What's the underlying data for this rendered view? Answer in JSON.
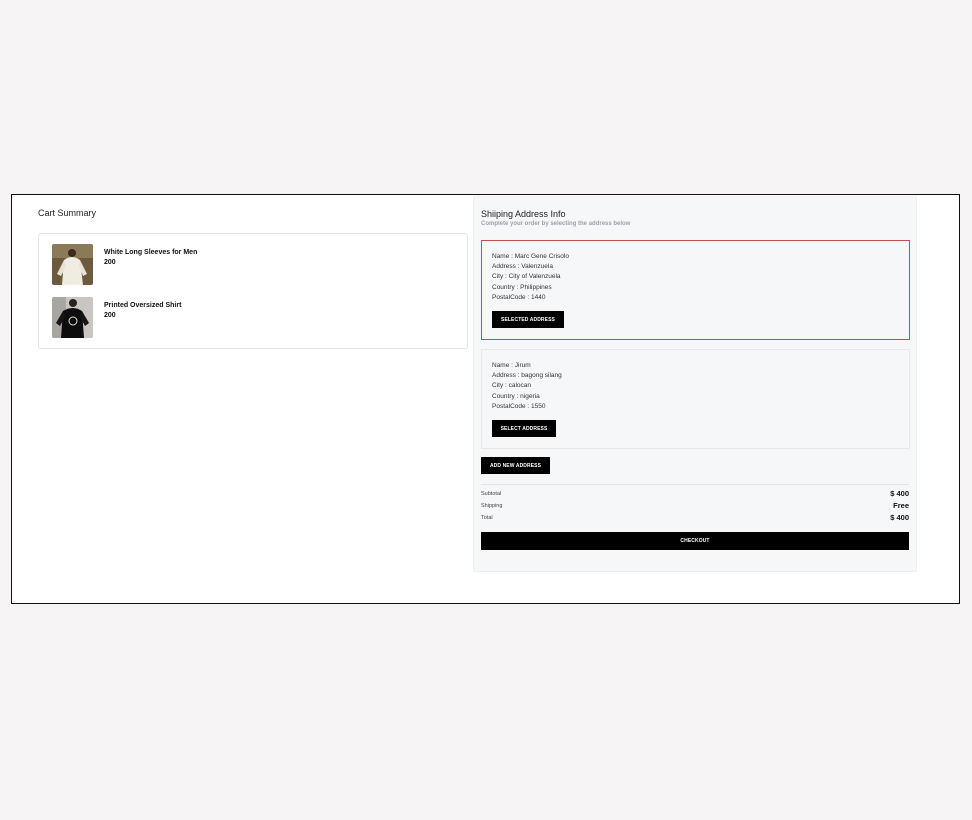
{
  "cart": {
    "title": "Cart Summary",
    "items": [
      {
        "name": "White Long Sleeves for Men",
        "price": "200"
      },
      {
        "name": "Printed Oversized Shirt",
        "price": "200"
      }
    ]
  },
  "shipping": {
    "title": "Shiiping Address Info",
    "subtitle": "Complete your order by selecting the address below",
    "addresses": [
      {
        "name": "Name : Marc Gene Crisolo",
        "address": "Address : Valenzuela",
        "city": "City : City of Valenzuela",
        "country": "Country : Philippines",
        "postal": "PostalCode : 1440",
        "button": "SELECTED ADDRESS"
      },
      {
        "name": "Name : Jirum",
        "address": "Address : bagong silang",
        "city": "City : calocan",
        "country": "Country : nigeria",
        "postal": "PostalCode : 1550",
        "button": "SELECT ADDRESS"
      }
    ],
    "add_new": "ADD NEW ADDRESS"
  },
  "summary": {
    "subtotal_label": "Subtotal",
    "subtotal_value": "$ 400",
    "shipping_label": "Shipping",
    "shipping_value": "Free",
    "total_label": "Total",
    "total_value": "$ 400",
    "checkout": "CHECKOUT"
  },
  "colors": {
    "selected_border": "#c0504d",
    "button_bg": "#000000"
  }
}
